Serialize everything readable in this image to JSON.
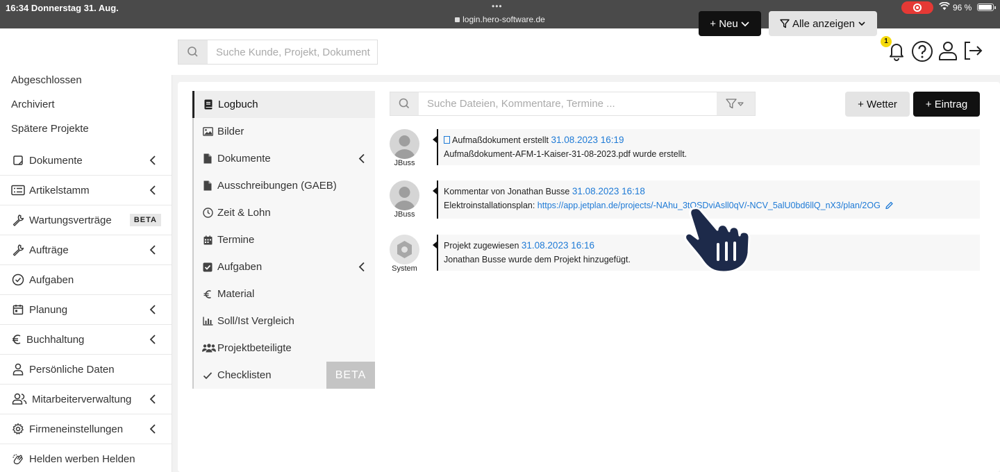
{
  "status_bar": {
    "time_date": "16:34  Donnerstag 31. Aug.",
    "dots": "•••",
    "url": "login.hero-software.de",
    "battery": "96 %"
  },
  "header": {
    "search_placeholder": "Suche Kunde, Projekt, Dokument",
    "new_button": "+ Neu",
    "filter_button": "Alle anzeigen",
    "notification_count": "1"
  },
  "sidebar": {
    "plain_items": [
      "Abgeschlossen",
      "Archiviert",
      "Spätere Projekte"
    ],
    "items": [
      {
        "label": "Dokumente",
        "icon": "document-icon",
        "chevron": true
      },
      {
        "label": "Artikelstamm",
        "icon": "list-icon",
        "chevron": true
      },
      {
        "label": "Wartungsverträge",
        "icon": "wrench-icon",
        "beta": "BETA"
      },
      {
        "label": "Aufträge",
        "icon": "wrench-icon",
        "chevron": true
      },
      {
        "label": "Aufgaben",
        "icon": "check-circle-icon"
      },
      {
        "label": "Planung",
        "icon": "calendar-icon",
        "chevron": true
      },
      {
        "label": "Buchhaltung",
        "icon": "euro-icon",
        "chevron": true
      },
      {
        "label": "Persönliche Daten",
        "icon": "user-icon"
      },
      {
        "label": "Mitarbeiterverwaltung",
        "icon": "users-icon",
        "chevron": true
      },
      {
        "label": "Firmeneinstellungen",
        "icon": "gear-icon",
        "chevron": true
      },
      {
        "label": "Helden werben Helden",
        "icon": "clap-icon"
      }
    ]
  },
  "subnav": {
    "items": [
      {
        "label": "Logbuch",
        "icon": "book-icon",
        "active": true
      },
      {
        "label": "Bilder",
        "icon": "image-icon"
      },
      {
        "label": "Dokumente",
        "icon": "file-icon",
        "chevron": true
      },
      {
        "label": "Ausschreibungen (GAEB)",
        "icon": "file-icon"
      },
      {
        "label": "Zeit & Lohn",
        "icon": "clock-icon"
      },
      {
        "label": "Termine",
        "icon": "calendar-icon"
      },
      {
        "label": "Aufgaben",
        "icon": "checkbox-icon",
        "chevron": true
      },
      {
        "label": "Material",
        "icon": "euro-icon"
      },
      {
        "label": "Soll/Ist Vergleich",
        "icon": "bar-chart-icon"
      },
      {
        "label": "Projektbeteiligte",
        "icon": "users-icon"
      },
      {
        "label": "Checklisten",
        "icon": "check-icon",
        "beta": "BETA"
      }
    ]
  },
  "log": {
    "search_placeholder": "Suche Dateien, Kommentare, Termine ...",
    "weather_button": "+ Wetter",
    "entry_button": "+ Eintrag",
    "entries": [
      {
        "author": "JBuss",
        "title": "Aufmaßdokument erstellt",
        "timestamp": "31.08.2023 16:19",
        "body": "Aufmaßdokument-AFM-1-Kaiser-31-08-2023.pdf wurde erstellt."
      },
      {
        "author": "JBuss",
        "title": "Kommentar von Jonathan Busse",
        "timestamp": "31.08.2023 16:18",
        "body_prefix": "Elektroinstallationsplan: ",
        "link": "https://app.jetplan.de/projects/-NAhu_3tQSDviAsll0qV/-NCV_5alU0bd6llQ_nX3/plan/2OG"
      },
      {
        "author": "System",
        "title": "Projekt zugewiesen",
        "timestamp": "31.08.2023 16:16",
        "body": "Jonathan Busse wurde dem Projekt hinzugefügt."
      }
    ]
  }
}
